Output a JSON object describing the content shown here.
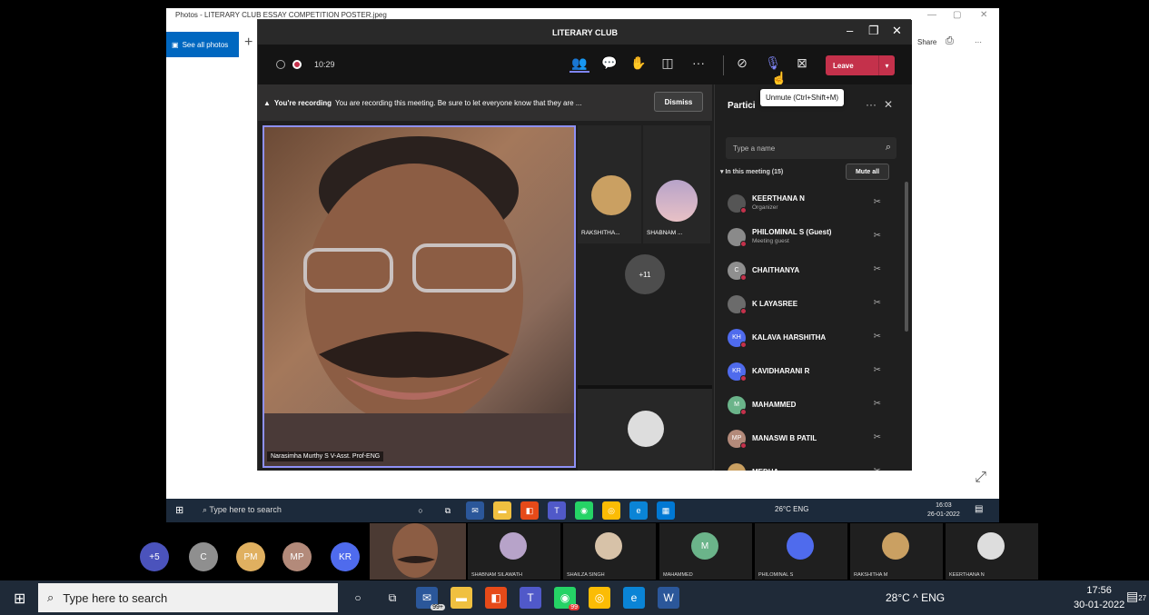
{
  "photos": {
    "title": "Photos - LITERARY CLUB ESSAY COMPETITION POSTER.jpeg",
    "see_all": "See all photos",
    "share": "Share",
    "more": "···"
  },
  "teams": {
    "title": "LITERARY CLUB",
    "timer": "10:29",
    "leave_label": "Leave",
    "tooltip": "Unmute (Ctrl+Shift+M)",
    "banner": {
      "heading": "You're recording",
      "text": "You are recording this meeting. Be sure to let everyone know that they are ...",
      "dismiss": "Dismiss"
    },
    "main_speaker": "Narasimha Murthy S V-Asst. Prof-ENG",
    "tiles": [
      {
        "name": "RAKSHITHA..."
      },
      {
        "name": "SHABNAM ..."
      }
    ],
    "overflow_count": "+11",
    "colors": {
      "accent": "#7f85f5",
      "leave": "#c4314b",
      "bg": "#1f1f1f"
    }
  },
  "participants": {
    "title": "Partici",
    "search_placeholder": "Type a name",
    "section": "In this meeting (15)",
    "mute_all": "Mute all",
    "list": [
      {
        "name": "KEERTHANA N",
        "sub": "Organizer",
        "initials": "",
        "color": "#555"
      },
      {
        "name": "PHILOMINAL S (Guest)",
        "sub": "Meeting guest",
        "initials": "",
        "color": "#8a8a8a"
      },
      {
        "name": "CHAITHANYA",
        "sub": "",
        "initials": "C",
        "color": "#8f8f8f"
      },
      {
        "name": "K LAYASREE",
        "sub": "",
        "initials": "",
        "color": "#6b6b6b"
      },
      {
        "name": "KALAVA HARSHITHA",
        "sub": "",
        "initials": "KH",
        "color": "#4f6bed"
      },
      {
        "name": "KAVIDHARANI R",
        "sub": "",
        "initials": "KR",
        "color": "#4f6bed"
      },
      {
        "name": "MAHAMMED",
        "sub": "",
        "initials": "M",
        "color": "#6bb48a"
      },
      {
        "name": "MANASWI B PATIL",
        "sub": "",
        "initials": "MP",
        "color": "#b38a7a"
      },
      {
        "name": "MEDHA",
        "sub": "",
        "initials": "",
        "color": "#caa062"
      }
    ]
  },
  "inner_taskbar": {
    "search": "Type here to search",
    "tray": "26°C  ENG",
    "time": "16:03",
    "date": "26-01-2022"
  },
  "gallery": {
    "circles": [
      {
        "label": "+5",
        "color": "#4b53bc"
      },
      {
        "label": "C",
        "color": "#8f8f8f"
      },
      {
        "label": "PM",
        "color": "#e0b060"
      },
      {
        "label": "MP",
        "color": "#b38a7a"
      },
      {
        "label": "KR",
        "color": "#4f6bed"
      }
    ],
    "tiles": [
      {
        "name": "SHABNAM SILAWATH",
        "color": "#b7a3c9"
      },
      {
        "name": "SHAILZA SINGH",
        "color": "#d7c2a8"
      },
      {
        "name": "MAHAMMED",
        "color": "#6bb48a",
        "initials": "M"
      },
      {
        "name": "PHILOMINAL S",
        "color": "#4f6bed"
      },
      {
        "name": "RAKSHITHA M",
        "color": "#caa062"
      },
      {
        "name": "KEERTHANA N",
        "color": "#ddd"
      }
    ]
  },
  "taskbar": {
    "search": "Type here to search",
    "tray": "28°C  ^  ENG",
    "time": "17:56",
    "date": "30-01-2022",
    "mail_badge": "99+",
    "whatsapp_badge": "99",
    "notification_count": "27"
  }
}
